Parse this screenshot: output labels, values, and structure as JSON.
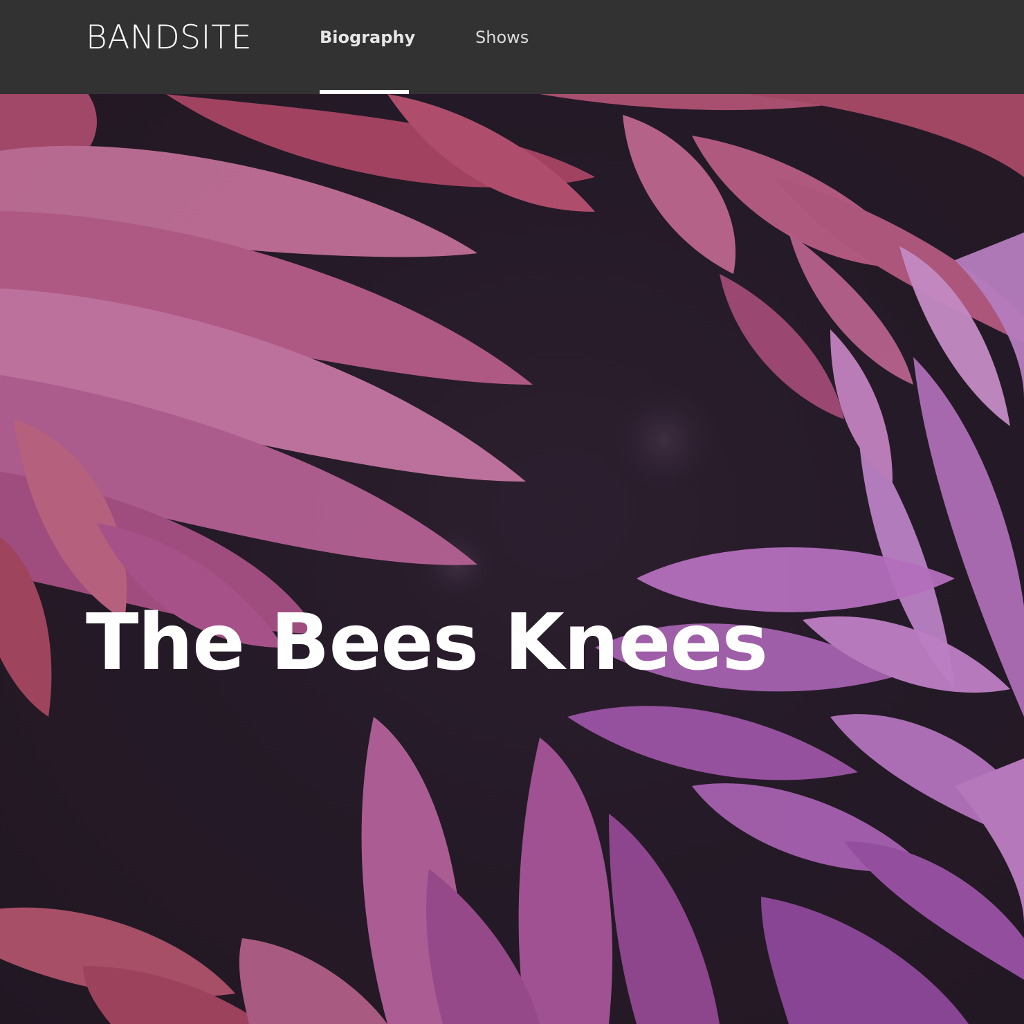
{
  "header": {
    "logo": "BANDSITE",
    "nav": {
      "biography": "Biography",
      "shows": "Shows"
    }
  },
  "hero": {
    "title": "The Bees Knees",
    "image": "flowers-background"
  },
  "colors": {
    "header_bg": "#323232",
    "active_indicator": "#ffffff",
    "hero_text": "#ffffff",
    "flower_pink": "#c0567c",
    "flower_purple": "#a64fb4"
  }
}
